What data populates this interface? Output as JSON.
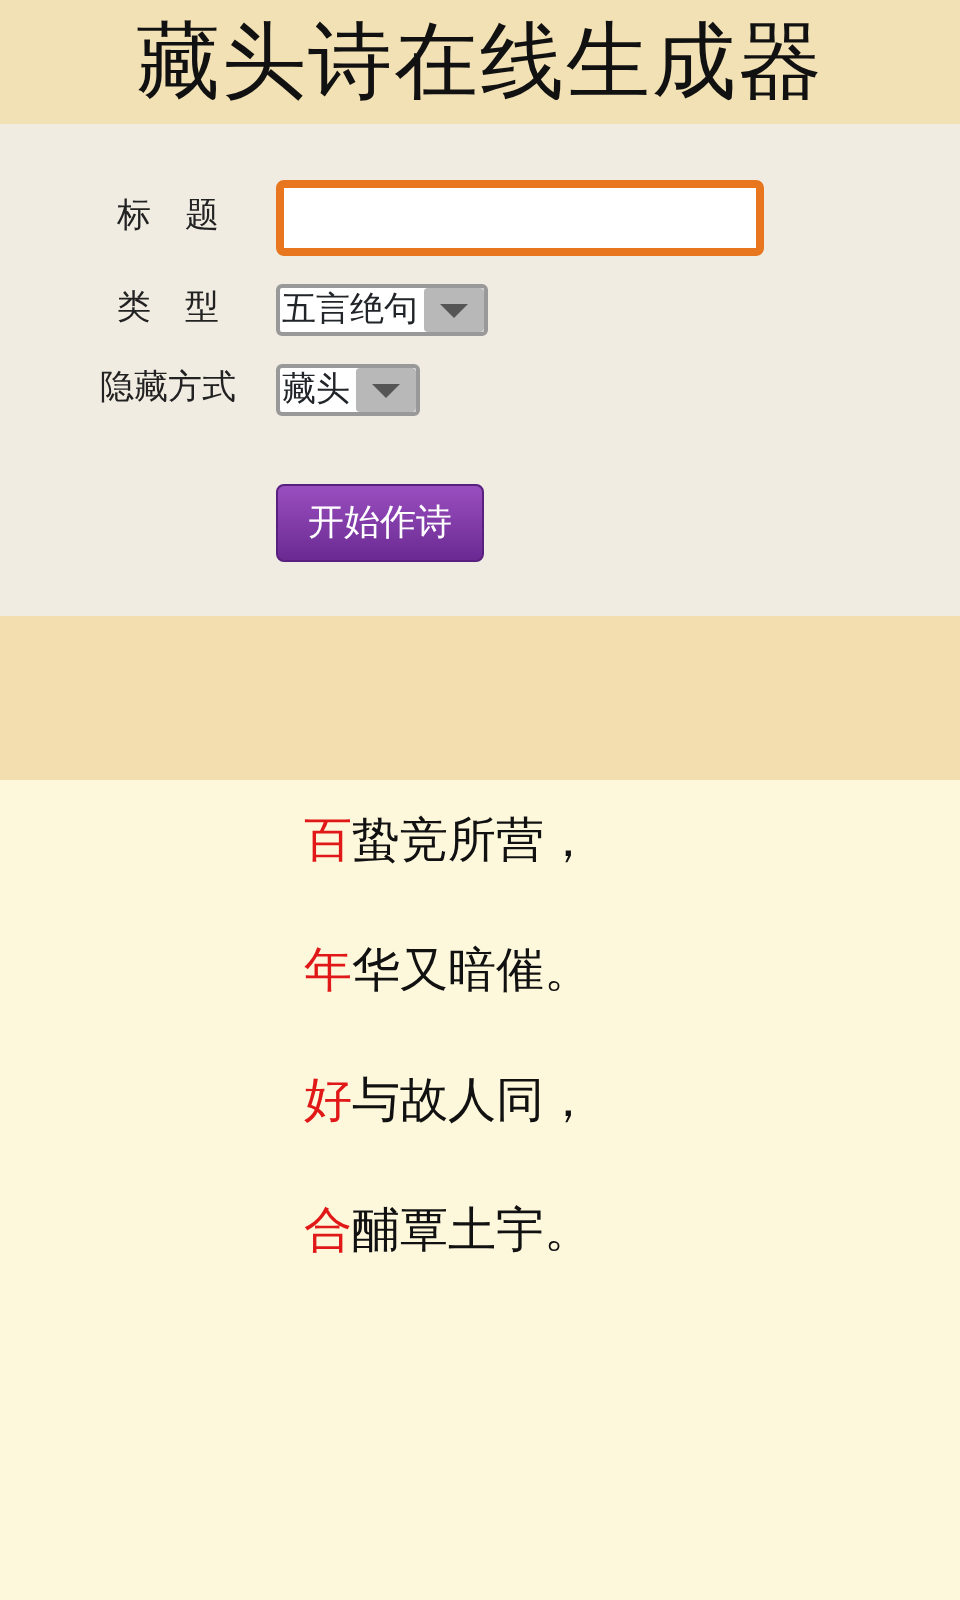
{
  "header": {
    "title": "藏头诗在线生成器"
  },
  "form": {
    "fields": [
      {
        "kind": "text",
        "label": "标　题",
        "focused": true
      },
      {
        "kind": "select",
        "label": "类　型",
        "value": "五言绝句"
      },
      {
        "kind": "select",
        "label": "隐藏方式",
        "value": "藏头"
      }
    ],
    "submit": "开始作诗"
  },
  "poem": [
    {
      "head": "百",
      "rest": "蛰竞所营，"
    },
    {
      "head": "年",
      "rest": "华又暗催。"
    },
    {
      "head": "好",
      "rest": "与故人同，"
    },
    {
      "head": "合",
      "rest": "酺覃土宇。"
    }
  ]
}
